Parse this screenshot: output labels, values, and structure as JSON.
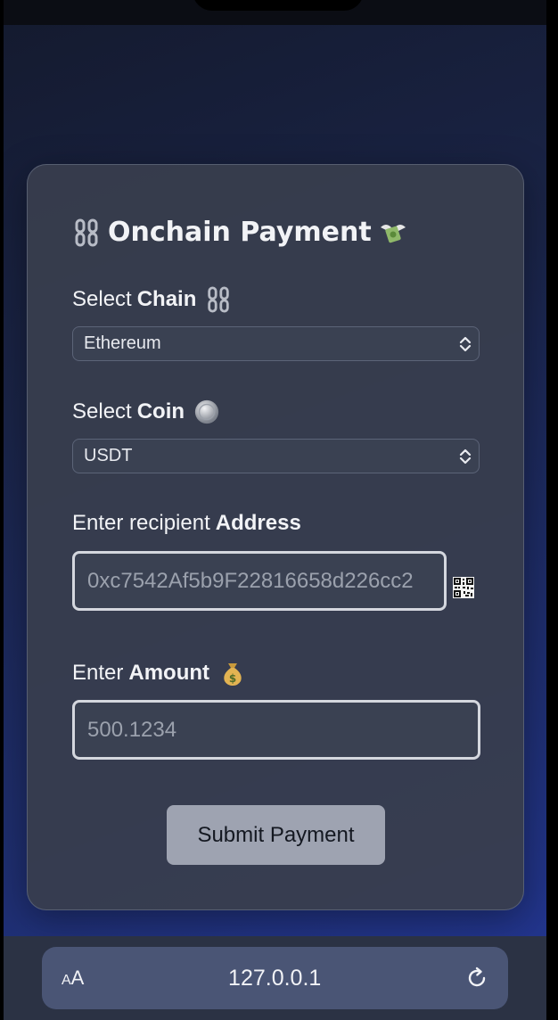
{
  "app": {
    "title": "Onchain Payment"
  },
  "form": {
    "chain_label_prefix": "Select ",
    "chain_label_bold": "Chain",
    "chain_value": "Ethereum",
    "coin_label_prefix": "Select ",
    "coin_label_bold": "Coin",
    "coin_value": "USDT",
    "address_label_prefix": "Enter recipient ",
    "address_label_bold": "Address",
    "address_placeholder": "0xc7542Af5b9F22816658d226cc2",
    "amount_label_prefix": "Enter ",
    "amount_label_bold": "Amount",
    "amount_placeholder": "500.1234",
    "submit_label": "Submit Payment"
  },
  "browser": {
    "text_size_small": "A",
    "text_size_large": "A",
    "url": "127.0.0.1"
  },
  "icons": {
    "title_left": "chain-link-icon",
    "title_right": "money-wings-icon",
    "chain_label": "chain-link-icon",
    "coin_label": "coin-icon",
    "amount_label": "money-bag-icon",
    "address_action": "qr-code-icon",
    "reload": "reload-icon"
  },
  "colors": {
    "card_bg": "#383e4e",
    "field_bg": "#3a4152",
    "field_border": "#d4d7de",
    "submit_bg": "#9ea3b1",
    "url_bar_bg": "#4a5575"
  }
}
